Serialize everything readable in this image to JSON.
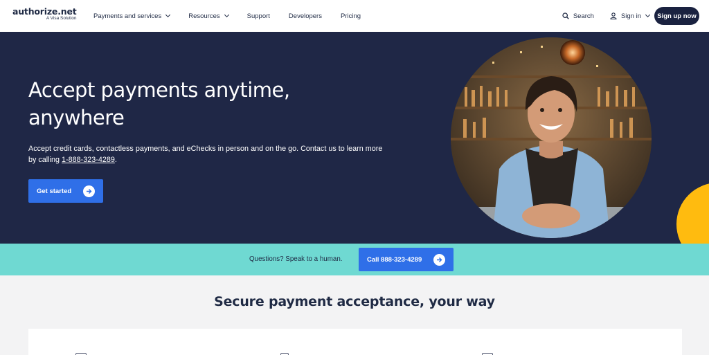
{
  "header": {
    "logo": {
      "name": "authorize.net",
      "tagline": "A Visa Solution"
    },
    "nav": [
      {
        "label": "Payments and services",
        "dropdown": true
      },
      {
        "label": "Resources",
        "dropdown": true
      },
      {
        "label": "Support",
        "dropdown": false
      },
      {
        "label": "Developers",
        "dropdown": false
      },
      {
        "label": "Pricing",
        "dropdown": false
      }
    ],
    "search_label": "Search",
    "signin_label": "Sign in",
    "signup_label": "Sign up now"
  },
  "hero": {
    "title": "Accept payments anytime, anywhere",
    "desc_before": "Accept credit cards, contactless payments, and eChecks in person and on the go. Contact us to learn more by calling ",
    "phone_link": "1-888-323-4289",
    "desc_after": ".",
    "cta_label": "Get started"
  },
  "band": {
    "text": "Questions? Speak to a human.",
    "cta_label": "Call 888-323-4289"
  },
  "section": {
    "title": "Secure payment acceptance, your way"
  },
  "colors": {
    "navy": "#1f2746",
    "blue": "#2f6fe8",
    "teal": "#6fd9d2",
    "yellow": "#ffbb0f"
  },
  "icons": [
    "search-icon",
    "user-icon",
    "chevron-down-icon",
    "arrow-right-icon"
  ]
}
